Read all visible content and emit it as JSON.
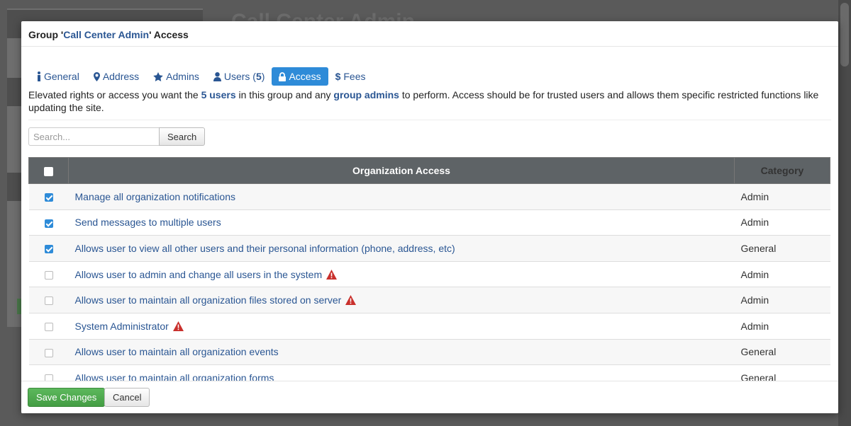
{
  "background": {
    "page_title": "Call Center Admin"
  },
  "modal": {
    "title_prefix": "Group '",
    "title_group": "Call Center Admin",
    "title_suffix": "' Access"
  },
  "tabs": [
    {
      "label": "General",
      "icon": "info-icon"
    },
    {
      "label": "Address",
      "icon": "map-marker-icon"
    },
    {
      "label": "Admins",
      "icon": "star-icon"
    },
    {
      "label": "Users",
      "count": "5",
      "icon": "user-icon"
    },
    {
      "label": "Access",
      "icon": "lock-icon",
      "active": true
    },
    {
      "label": "Fees",
      "icon": "dollar-icon"
    }
  ],
  "description": {
    "part1": "Elevated rights or access you want the ",
    "users_link": "5 users",
    "part2": " in this group and any ",
    "admins_link": "group admins",
    "part3": " to perform. Access should be for trusted users and allows them specific restricted functions like updating the site."
  },
  "search": {
    "placeholder": "Search...",
    "button_label": "Search"
  },
  "table": {
    "headers": {
      "access": "Organization Access",
      "category": "Category"
    },
    "rows": [
      {
        "name": "Manage all organization notifications",
        "category": "Admin",
        "checked": true,
        "warning": false
      },
      {
        "name": "Send messages to multiple users",
        "category": "Admin",
        "checked": true,
        "warning": false
      },
      {
        "name": "Allows user to view all other users and their personal information (phone, address, etc)",
        "category": "General",
        "checked": true,
        "warning": false
      },
      {
        "name": "Allows user to admin and change all users in the system",
        "category": "Admin",
        "checked": false,
        "warning": true
      },
      {
        "name": "Allows user to maintain all organization files stored on server",
        "category": "Admin",
        "checked": false,
        "warning": true
      },
      {
        "name": "System Administrator",
        "category": "Admin",
        "checked": false,
        "warning": true
      },
      {
        "name": "Allows user to maintain all organization events",
        "category": "General",
        "checked": false,
        "warning": false
      },
      {
        "name": "Allows user to maintain all organization forms",
        "category": "General",
        "checked": false,
        "warning": false
      }
    ]
  },
  "footer": {
    "save_label": "Save Changes",
    "cancel_label": "Cancel"
  },
  "colors": {
    "link": "#2a5693",
    "active_tab": "#2e8bd8",
    "header_bg": "#5e6366",
    "save_green": "#5cb85c",
    "warning_red": "#c9302c"
  }
}
